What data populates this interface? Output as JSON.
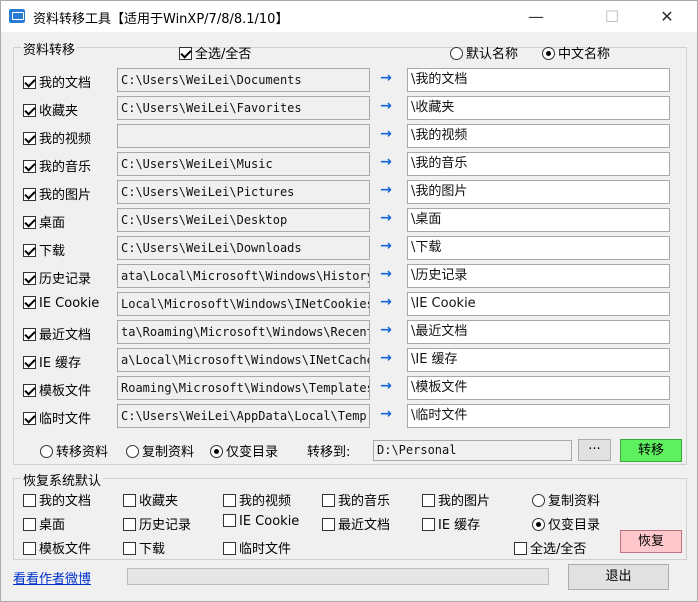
{
  "window": {
    "title": "资料转移工具【适用于WinXP/7/8/8.1/10】",
    "minimize": "—",
    "maximize": "☐",
    "close": "✕"
  },
  "transfer_group": {
    "legend": "资料转移",
    "select_all_label": "全选/全否",
    "select_all_checked": true,
    "name_mode": [
      {
        "label": "默认名称",
        "selected": false
      },
      {
        "label": "中文名称",
        "selected": true
      }
    ],
    "arrow": "→",
    "rows": [
      {
        "label": "我的文档",
        "checked": true,
        "source": "C:\\Users\\WeiLei\\Documents",
        "target": "\\我的文档"
      },
      {
        "label": "收藏夹",
        "checked": true,
        "source": "C:\\Users\\WeiLei\\Favorites",
        "target": "\\收藏夹"
      },
      {
        "label": "我的视频",
        "checked": true,
        "source": "",
        "target": "\\我的视频"
      },
      {
        "label": "我的音乐",
        "checked": true,
        "source": "C:\\Users\\WeiLei\\Music",
        "target": "\\我的音乐"
      },
      {
        "label": "我的图片",
        "checked": true,
        "source": "C:\\Users\\WeiLei\\Pictures",
        "target": "\\我的图片"
      },
      {
        "label": "桌面",
        "checked": true,
        "source": "C:\\Users\\WeiLei\\Desktop",
        "target": "\\桌面"
      },
      {
        "label": "下载",
        "checked": true,
        "source": "C:\\Users\\WeiLei\\Downloads",
        "target": "\\下载"
      },
      {
        "label": "历史记录",
        "checked": true,
        "source": "ata\\Local\\Microsoft\\Windows\\History",
        "target": "\\历史记录"
      },
      {
        "label": "IE Cookie",
        "checked": true,
        "source": "Local\\Microsoft\\Windows\\INetCookies",
        "target": "\\IE Cookie"
      },
      {
        "label": "最近文档",
        "checked": true,
        "source": "ta\\Roaming\\Microsoft\\Windows\\Recent",
        "target": "\\最近文档"
      },
      {
        "label": "IE 缓存",
        "checked": true,
        "source": "a\\Local\\Microsoft\\Windows\\INetCache",
        "target": "\\IE 缓存"
      },
      {
        "label": "模板文件",
        "checked": true,
        "source": "Roaming\\Microsoft\\Windows\\Templates",
        "target": "\\模板文件"
      },
      {
        "label": "临时文件",
        "checked": true,
        "source": "C:\\Users\\WeiLei\\AppData\\Local\\Temp",
        "target": "\\临时文件"
      }
    ],
    "mode_options": [
      {
        "label": "转移资料",
        "selected": false
      },
      {
        "label": "复制资料",
        "selected": false
      },
      {
        "label": "仅变目录",
        "selected": true
      }
    ],
    "transfer_to_label": "转移到:",
    "transfer_to_value": "D:\\Personal",
    "browse_label": "···",
    "transfer_button": "转移"
  },
  "restore_group": {
    "legend": "恢复系统默认",
    "items": [
      {
        "label": "我的文档",
        "checked": false
      },
      {
        "label": "收藏夹",
        "checked": false
      },
      {
        "label": "我的视频",
        "checked": false
      },
      {
        "label": "我的音乐",
        "checked": false
      },
      {
        "label": "我的图片",
        "checked": false
      },
      {
        "label": "桌面",
        "checked": false
      },
      {
        "label": "历史记录",
        "checked": false
      },
      {
        "label": "IE Cookie",
        "checked": false
      },
      {
        "label": "最近文档",
        "checked": false
      },
      {
        "label": "IE 缓存",
        "checked": false
      },
      {
        "label": "模板文件",
        "checked": false
      },
      {
        "label": "下载",
        "checked": false
      },
      {
        "label": "临时文件",
        "checked": false
      }
    ],
    "mode_options": [
      {
        "label": "复制资料",
        "selected": false
      },
      {
        "label": "仅变目录",
        "selected": true
      }
    ],
    "select_all_label": "全选/全否",
    "select_all_checked": false,
    "restore_button": "恢复"
  },
  "footer": {
    "author_link": "看看作者微博",
    "progress": 0,
    "exit_button": "退出"
  },
  "colors": {
    "arrow": "#1464d8",
    "transfer_button": "#5ef05e",
    "restore_button": "#ffc8cc",
    "link": "#0033cc"
  }
}
